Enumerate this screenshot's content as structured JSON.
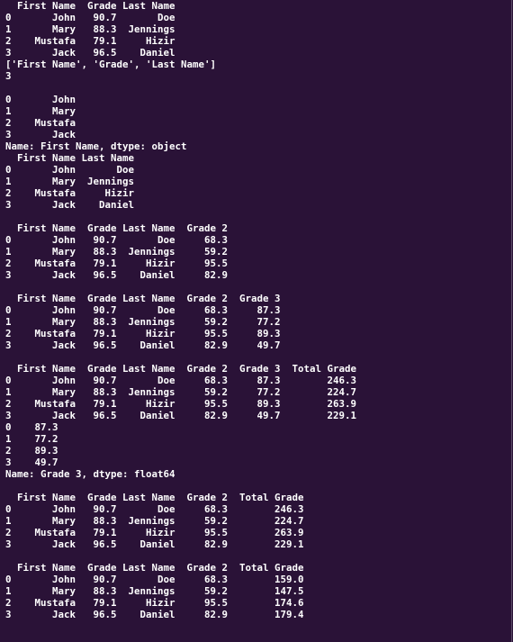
{
  "terminal": {
    "lines": [
      "  First Name  Grade Last Name",
      "0       John   90.7       Doe",
      "1       Mary   88.3  Jennings",
      "2    Mustafa   79.1     Hizir",
      "3       Jack   96.5    Daniel",
      "['First Name', 'Grade', 'Last Name']",
      "3",
      "",
      "0       John",
      "1       Mary",
      "2    Mustafa",
      "3       Jack",
      "Name: First Name, dtype: object",
      "  First Name Last Name",
      "0       John       Doe",
      "1       Mary  Jennings",
      "2    Mustafa     Hizir",
      "3       Jack    Daniel",
      "",
      "  First Name  Grade Last Name  Grade 2",
      "0       John   90.7       Doe     68.3",
      "1       Mary   88.3  Jennings     59.2",
      "2    Mustafa   79.1     Hizir     95.5",
      "3       Jack   96.5    Daniel     82.9",
      "",
      "  First Name  Grade Last Name  Grade 2  Grade 3",
      "0       John   90.7       Doe     68.3     87.3",
      "1       Mary   88.3  Jennings     59.2     77.2",
      "2    Mustafa   79.1     Hizir     95.5     89.3",
      "3       Jack   96.5    Daniel     82.9     49.7",
      "",
      "  First Name  Grade Last Name  Grade 2  Grade 3  Total Grade",
      "0       John   90.7       Doe     68.3     87.3        246.3",
      "1       Mary   88.3  Jennings     59.2     77.2        224.7",
      "2    Mustafa   79.1     Hizir     95.5     89.3        263.9",
      "3       Jack   96.5    Daniel     82.9     49.7        229.1",
      "0    87.3",
      "1    77.2",
      "2    89.3",
      "3    49.7",
      "Name: Grade 3, dtype: float64",
      "",
      "  First Name  Grade Last Name  Grade 2  Total Grade",
      "0       John   90.7       Doe     68.3        246.3",
      "1       Mary   88.3  Jennings     59.2        224.7",
      "2    Mustafa   79.1     Hizir     95.5        263.9",
      "3       Jack   96.5    Daniel     82.9        229.1",
      "",
      "  First Name  Grade Last Name  Grade 2  Total Grade",
      "0       John   90.7       Doe     68.3        159.0",
      "1       Mary   88.3  Jennings     59.2        147.5",
      "2    Mustafa   79.1     Hizir     95.5        174.6",
      "3       Jack   96.5    Daniel     82.9        179.4"
    ]
  },
  "colors": {
    "background": "#2a1237",
    "text": "#ffffff"
  }
}
